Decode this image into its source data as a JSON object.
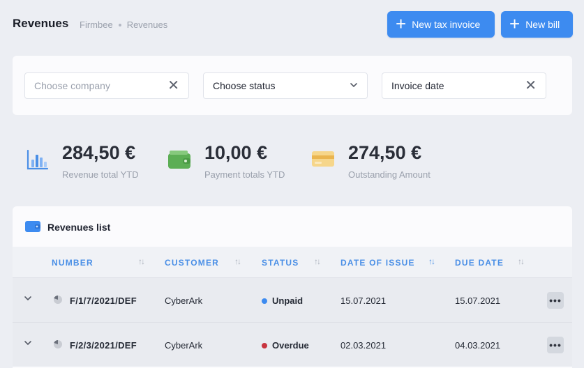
{
  "header": {
    "title": "Revenues",
    "breadcrumb": [
      "Firmbee",
      "Revenues"
    ],
    "btn_tax_invoice": "New tax invoice",
    "btn_new_bill": "New bill",
    "accent": "#3d8bf0"
  },
  "filters": {
    "company_placeholder": "Choose company",
    "status_value": "Choose status",
    "date_value": "Invoice date"
  },
  "stats": [
    {
      "value": "284,50 €",
      "label": "Revenue total YTD",
      "icon": "bar-chart-icon"
    },
    {
      "value": "10,00 €",
      "label": "Payment totals YTD",
      "icon": "wallet-icon"
    },
    {
      "value": "274,50 €",
      "label": "Outstanding Amount",
      "icon": "card-icon"
    }
  ],
  "list": {
    "title": "Revenues list",
    "columns": [
      "NUMBER",
      "CUSTOMER",
      "STATUS",
      "DATE OF ISSUE",
      "DUE DATE"
    ],
    "rows": [
      {
        "number": "F/1/7/2021/DEF",
        "customer": "CyberArk",
        "status": "Unpaid",
        "status_color": "#3d8bf0",
        "issue": "15.07.2021",
        "due": "15.07.2021"
      },
      {
        "number": "F/2/3/2021/DEF",
        "customer": "CyberArk",
        "status": "Overdue",
        "status_color": "#c8343f",
        "issue": "02.03.2021",
        "due": "04.03.2021"
      }
    ]
  }
}
